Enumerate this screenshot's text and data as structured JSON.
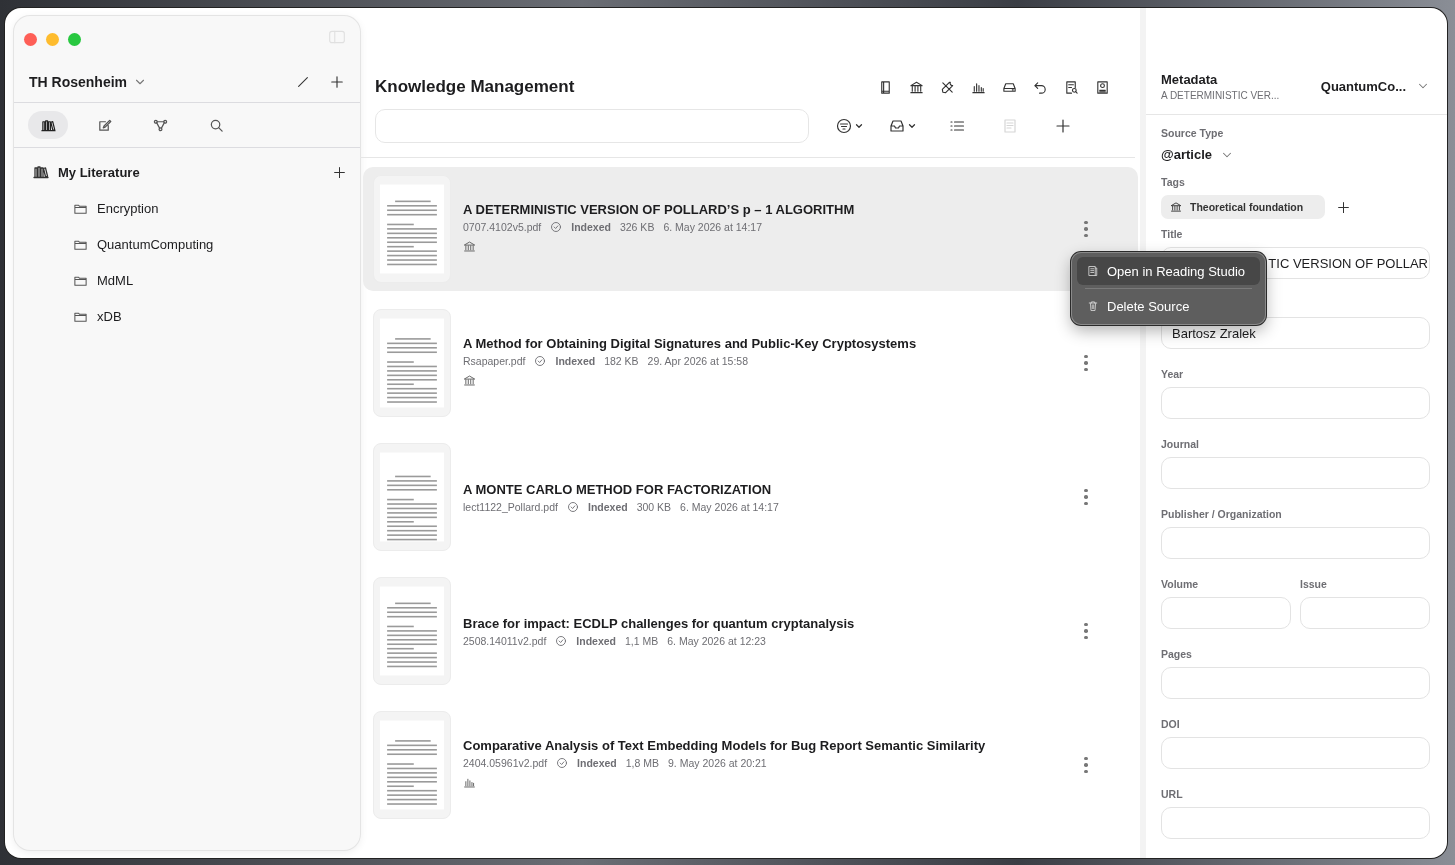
{
  "sidebar": {
    "workspace": "TH Rosenheim",
    "tabs": [
      {
        "kind": "library",
        "selected": true
      },
      {
        "kind": "note",
        "selected": false
      },
      {
        "kind": "graph",
        "selected": false
      },
      {
        "kind": "search",
        "selected": false
      }
    ],
    "tree": {
      "label": "My Literature",
      "children": [
        {
          "label": "Encryption"
        },
        {
          "label": "QuantumComputing"
        },
        {
          "label": "MdML"
        },
        {
          "label": "xDB"
        }
      ]
    }
  },
  "main": {
    "title": "Knowledge Management",
    "toolbar": [
      {
        "kind": "book"
      },
      {
        "kind": "institution"
      },
      {
        "kind": "tools"
      },
      {
        "kind": "chart"
      },
      {
        "kind": "drive"
      },
      {
        "kind": "undo"
      },
      {
        "kind": "doc-search"
      },
      {
        "kind": "contact"
      }
    ],
    "actions": [
      {
        "kind": "filter",
        "disabled": false
      },
      {
        "kind": "inbox",
        "disabled": false
      },
      {
        "kind": "list",
        "disabled": false
      },
      {
        "kind": "doc",
        "disabled": true
      },
      {
        "kind": "plus",
        "disabled": false
      }
    ],
    "sources": [
      {
        "title": "A DETERMINISTIC VERSION OF POLLARD’S p – 1 ALGORITHM",
        "file": "0707.4102v5.pdf",
        "status": "Indexed",
        "size": "326 KB",
        "date": "6. May 2026 at 14:17",
        "tag_icon": {
          "kind": "institution"
        },
        "selected": true
      },
      {
        "title": "A Method for Obtaining Digital Signatures and Public-Key Cryptosystems",
        "file": "Rsapaper.pdf",
        "status": "Indexed",
        "size": "182 KB",
        "date": "29. Apr 2026 at 15:58",
        "tag_icon": {
          "kind": "institution"
        },
        "selected": false
      },
      {
        "title": "A MONTE CARLO METHOD FOR FACTORIZATION",
        "file": "lect1122_Pollard.pdf",
        "status": "Indexed",
        "size": "300 KB",
        "date": "6. May 2026 at 14:17",
        "selected": false
      },
      {
        "title": "Brace for impact: ECDLP challenges for quantum cryptanalysis",
        "file": "2508.14011v2.pdf",
        "status": "Indexed",
        "size": "1,1 MB",
        "date": "6. May 2026 at 12:23",
        "selected": false
      },
      {
        "title": "Comparative Analysis of Text Embedding Models for Bug Report Semantic Similarity",
        "file": "2404.05961v2.pdf",
        "status": "Indexed",
        "size": "1,8 MB",
        "date": "9. May 2026 at 20:21",
        "tag_icon": {
          "kind": "chart"
        },
        "selected": false
      }
    ]
  },
  "context_menu": {
    "items": [
      {
        "label": "Open in Reading Studio",
        "kind": "reading",
        "selected": true
      },
      {
        "label": "Delete Source",
        "kind": "delete",
        "selected": false
      }
    ]
  },
  "metadata": {
    "title": "Metadata",
    "subtitle": "A DETERMINISTIC VER...",
    "collection": "QuantumCo...",
    "source_type_label": "Source Type",
    "source_type": "@article",
    "tags_label": "Tags",
    "tags": [
      {
        "label": "Theoretical foundation"
      }
    ],
    "rows": [
      [
        {
          "label": "Title",
          "value": "TIC VERSION OF POLLAR"
        }
      ],
      [
        {
          "value": "Bartosz Zralek"
        }
      ],
      [
        {
          "label": "Year"
        }
      ],
      [
        {
          "label": "Journal"
        }
      ],
      [
        {
          "label": "Publisher / Organization"
        }
      ],
      [
        {
          "label": "Volume"
        },
        {
          "label": "Issue"
        }
      ],
      [
        {
          "label": "Pages"
        }
      ],
      [
        {
          "label": "DOI"
        }
      ],
      [
        {
          "label": "URL"
        }
      ]
    ]
  }
}
